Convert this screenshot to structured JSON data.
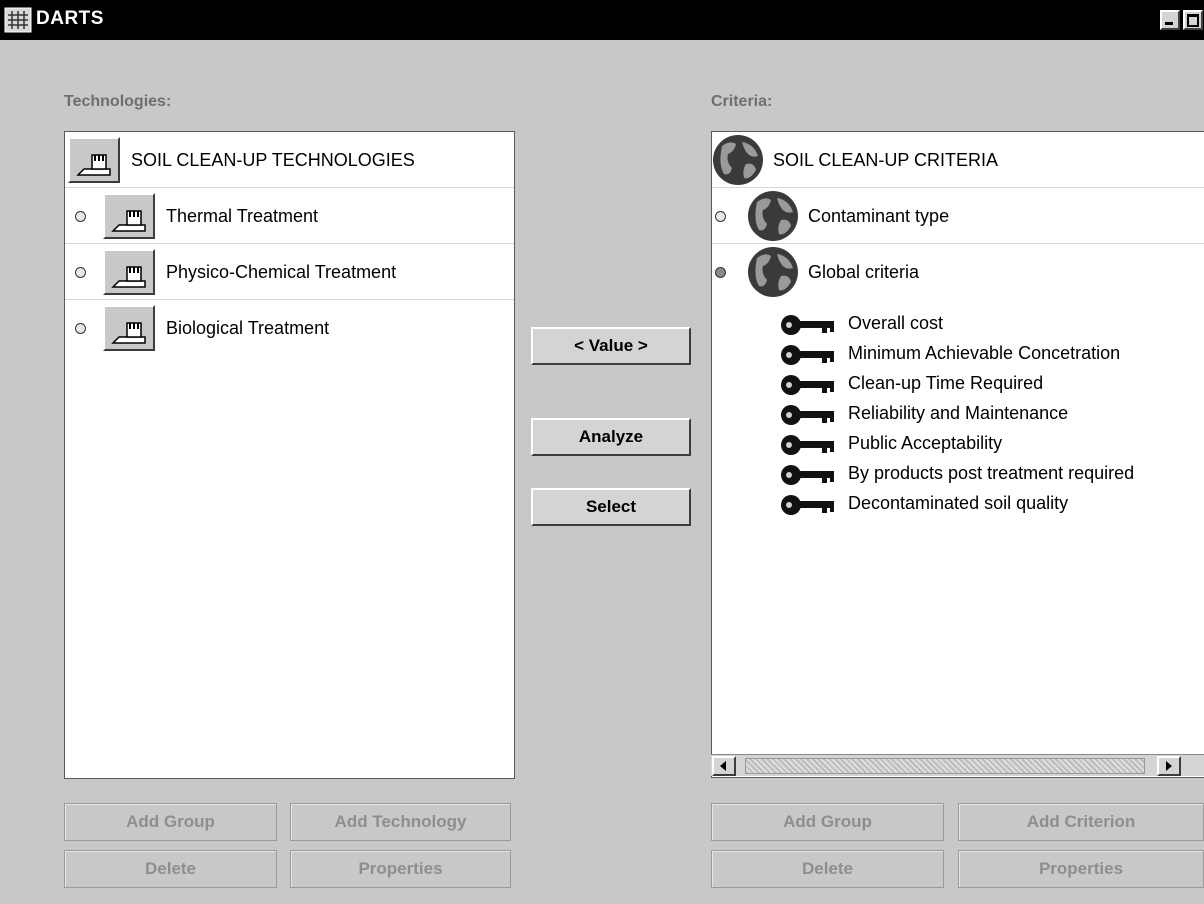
{
  "window": {
    "title": "DARTS"
  },
  "technologies": {
    "label": "Technologies:",
    "root": "SOIL CLEAN-UP TECHNOLOGIES",
    "items": [
      "Thermal Treatment",
      "Physico-Chemical Treatment",
      "Biological Treatment"
    ]
  },
  "criteria": {
    "label": "Criteria:",
    "root": "SOIL CLEAN-UP CRITERIA",
    "groups": [
      "Contaminant type",
      "Global criteria"
    ],
    "items": [
      "Overall cost",
      "Minimum Achievable Concetration",
      "Clean-up Time Required",
      "Reliability and Maintenance",
      "Public Acceptability",
      "By products post treatment required",
      "Decontaminated soil quality"
    ]
  },
  "middle": {
    "value_label": "< Value >",
    "analyze_label": "Analyze",
    "select_label": "Select"
  },
  "tech_buttons": {
    "add_group": "Add Group",
    "add_technology": "Add Technology",
    "delete": "Delete",
    "properties": "Properties"
  },
  "crit_buttons": {
    "add_group": "Add Group",
    "add_criterion": "Add Criterion",
    "delete": "Delete",
    "properties": "Properties"
  },
  "icons": {
    "app": "app-icon",
    "technology": "factory-icon",
    "criteria": "globe-icon",
    "criterion": "key-icon"
  }
}
